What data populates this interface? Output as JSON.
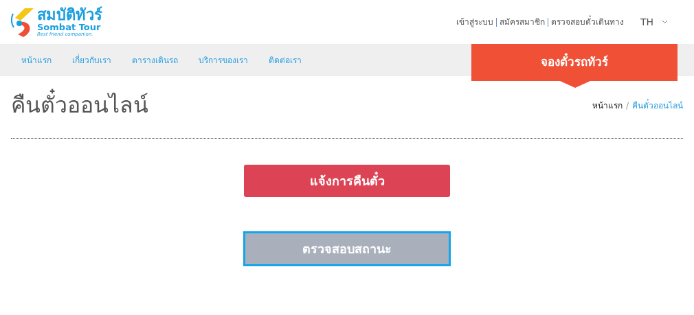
{
  "logo": {
    "thai_name": "สมบัติทัวร์",
    "name": "Sombat Tour",
    "tagline": "Best friend companion."
  },
  "top_links": [
    "เข้าสู่ระบบ",
    "สมัครสมาชิก",
    "ตรวจสอบตั๋วเดินทาง"
  ],
  "language": "TH",
  "nav": [
    "หน้าแรก",
    "เกี่ยวกับเรา",
    "ตารางเดินรถ",
    "บริการของเรา",
    "ติดต่อเรา"
  ],
  "book_button": "จองตั๋วรถทัวร์",
  "page_title": "คืนตั๋วออนไลน์",
  "breadcrumb_separator": "/",
  "breadcrumb": [
    {
      "label": "หน้าแรก",
      "selected": false
    },
    {
      "label": "คืนตั๋วออนไลน์",
      "selected": true
    }
  ],
  "actions": [
    {
      "label": "แจ้งการคืนตั๋ว",
      "kind": "primary"
    },
    {
      "label": "ตรวจสอบสถานะ",
      "kind": "secondary"
    }
  ]
}
